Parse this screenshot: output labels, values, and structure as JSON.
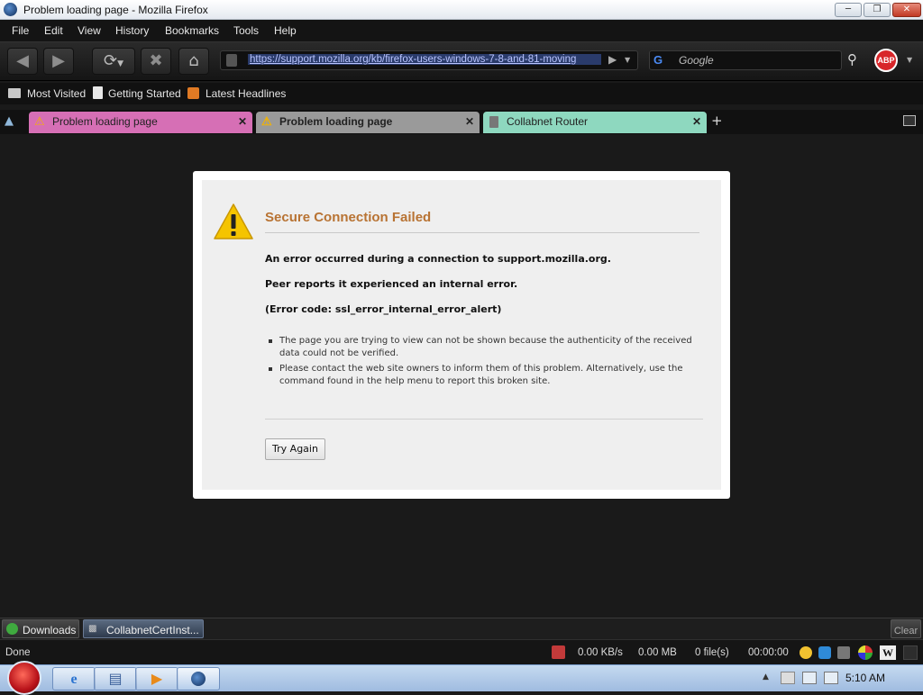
{
  "window": {
    "title": "Problem loading page - Mozilla Firefox",
    "min_glyph": "─",
    "max_glyph": "❐",
    "close_glyph": "✕"
  },
  "menu": [
    "File",
    "Edit",
    "View",
    "History",
    "Bookmarks",
    "Tools",
    "Help"
  ],
  "nav": {
    "url": "https://support.mozilla.org/kb/firefox-users-windows-7-8-and-81-moving",
    "search_placeholder": "Google",
    "abp": "ABP"
  },
  "bookmarks": [
    "Most Visited",
    "Getting Started",
    "Latest Headlines"
  ],
  "tabs": [
    {
      "label": "Problem loading page",
      "color": "#d66fb5"
    },
    {
      "label": "Problem loading page",
      "color": "#9a9a9a"
    },
    {
      "label": "Collabnet Router",
      "color": "#8ed8bf"
    }
  ],
  "error": {
    "title": "Secure Connection Failed",
    "p1": "An error occurred during a connection to support.mozilla.org.",
    "p2": "Peer reports it experienced an internal error.",
    "p3": "(Error code: ssl_error_internal_error_alert)",
    "bullet1": "The page you are trying to view can not be shown because the authenticity of the received data could not be verified.",
    "bullet2": "Please contact the web site owners to inform them of this problem. Alternatively, use the command found in the help menu to report this broken site.",
    "button": "Try Again"
  },
  "downloads": {
    "label": "Downloads",
    "item": "CollabnetCertInst...",
    "clear": "Clear"
  },
  "status": {
    "text": "Done",
    "speed": "0.00 KB/s",
    "size": "0.00 MB",
    "files": "0 file(s)",
    "time": "00:00:00"
  },
  "taskbar": {
    "clock": "5:10 AM"
  }
}
